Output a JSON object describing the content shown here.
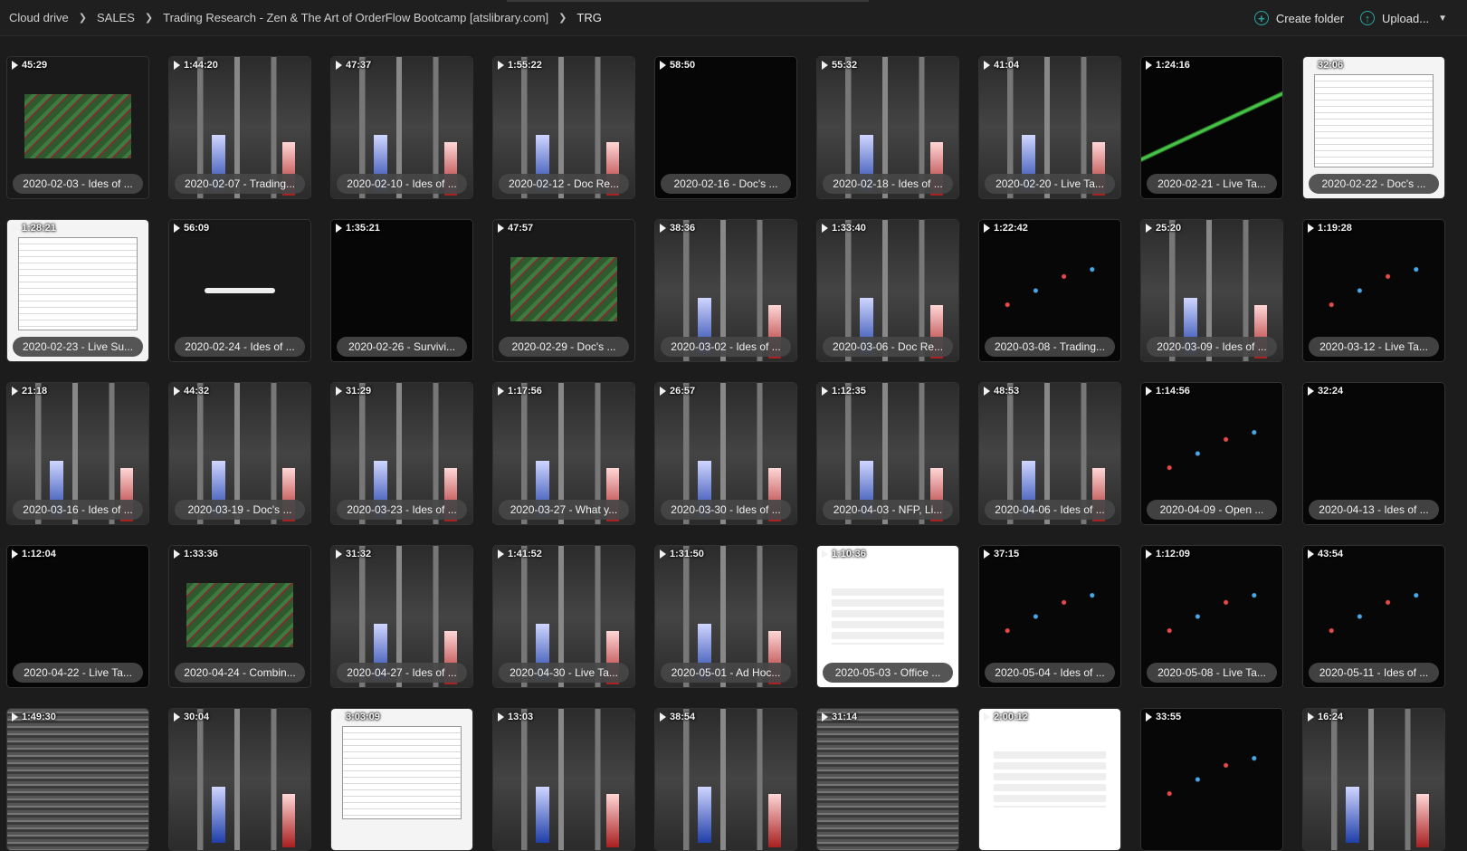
{
  "breadcrumb": [
    {
      "label": "Cloud drive"
    },
    {
      "label": "SALES"
    },
    {
      "label": "Trading Research - Zen & The Art of OrderFlow Bootcamp [atslibrary.com]"
    },
    {
      "label": "TRG"
    }
  ],
  "actions": {
    "create_folder": "Create folder",
    "upload": "Upload..."
  },
  "colors": {
    "accent": "#2aa7a2",
    "background": "#1c1c1d"
  },
  "tiles": [
    {
      "duration": "45:29",
      "title": "2020-02-03 - Ides of ...",
      "thumb": "promo"
    },
    {
      "duration": "1:44:20",
      "title": "2020-02-07 - Trading...",
      "thumb": "orderflow"
    },
    {
      "duration": "47:37",
      "title": "2020-02-10 - Ides of ...",
      "thumb": "orderflow"
    },
    {
      "duration": "1:55:22",
      "title": "2020-02-12 - Doc Re...",
      "thumb": "orderflow"
    },
    {
      "duration": "58:50",
      "title": "2020-02-16 - Doc's ...",
      "thumb": "dark"
    },
    {
      "duration": "55:32",
      "title": "2020-02-18 - Ides of ...",
      "thumb": "orderflow"
    },
    {
      "duration": "41:04",
      "title": "2020-02-20 - Live Ta...",
      "thumb": "orderflow"
    },
    {
      "duration": "1:24:16",
      "title": "2020-02-21 - Live Ta...",
      "thumb": "line"
    },
    {
      "duration": "32:06",
      "title": "2020-02-22 - Doc's ...",
      "thumb": "sheet"
    },
    {
      "duration": "1:28:21",
      "title": "2020-02-23 - Live Su...",
      "thumb": "sheet"
    },
    {
      "duration": "56:09",
      "title": "2020-02-24 - Ides of ...",
      "thumb": "google"
    },
    {
      "duration": "1:35:21",
      "title": "2020-02-26 - Survivi...",
      "thumb": "dark"
    },
    {
      "duration": "47:57",
      "title": "2020-02-29 - Doc's ...",
      "thumb": "promo"
    },
    {
      "duration": "38:36",
      "title": "2020-03-02 - Ides of ...",
      "thumb": "orderflow"
    },
    {
      "duration": "1:33:40",
      "title": "2020-03-06 - Doc Re...",
      "thumb": "orderflow"
    },
    {
      "duration": "1:22:42",
      "title": "2020-03-08 - Trading...",
      "thumb": "candles"
    },
    {
      "duration": "25:20",
      "title": "2020-03-09 - Ides of ...",
      "thumb": "orderflow"
    },
    {
      "duration": "1:19:28",
      "title": "2020-03-12 - Live Ta...",
      "thumb": "candles"
    },
    {
      "duration": "21:18",
      "title": "2020-03-16 - Ides of ...",
      "thumb": "orderflow"
    },
    {
      "duration": "44:32",
      "title": "2020-03-19 - Doc's ...",
      "thumb": "orderflow"
    },
    {
      "duration": "31:29",
      "title": "2020-03-23 - Ides of ...",
      "thumb": "orderflow"
    },
    {
      "duration": "1:17:56",
      "title": "2020-03-27 - What y...",
      "thumb": "orderflow"
    },
    {
      "duration": "26:57",
      "title": "2020-03-30 - Ides of ...",
      "thumb": "orderflow"
    },
    {
      "duration": "1:12:35",
      "title": "2020-04-03 - NFP, Li...",
      "thumb": "orderflow"
    },
    {
      "duration": "48:53",
      "title": "2020-04-06 - Ides of ...",
      "thumb": "orderflow"
    },
    {
      "duration": "1:14:56",
      "title": "2020-04-09 - Open ...",
      "thumb": "candles"
    },
    {
      "duration": "32:24",
      "title": "2020-04-13 - Ides of ...",
      "thumb": "dark"
    },
    {
      "duration": "1:12:04",
      "title": "2020-04-22 - Live Ta...",
      "thumb": "dark"
    },
    {
      "duration": "1:33:36",
      "title": "2020-04-24 - Combin...",
      "thumb": "promo"
    },
    {
      "duration": "31:32",
      "title": "2020-04-27 - Ides of ...",
      "thumb": "orderflow"
    },
    {
      "duration": "1:41:52",
      "title": "2020-04-30 - Live Ta...",
      "thumb": "orderflow"
    },
    {
      "duration": "1:31:50",
      "title": "2020-05-01 - Ad Hoc...",
      "thumb": "orderflow"
    },
    {
      "duration": "1:10:36",
      "title": "2020-05-03 - Office ...",
      "thumb": "white"
    },
    {
      "duration": "37:15",
      "title": "2020-05-04 - Ides of ...",
      "thumb": "candles"
    },
    {
      "duration": "1:12:09",
      "title": "2020-05-08 - Live Ta...",
      "thumb": "candles"
    },
    {
      "duration": "43:54",
      "title": "2020-05-11 - Ides of ...",
      "thumb": "candles"
    },
    {
      "duration": "1:49:30",
      "title": "",
      "thumb": "heat"
    },
    {
      "duration": "30:04",
      "title": "",
      "thumb": "orderflow"
    },
    {
      "duration": "3:03:09",
      "title": "",
      "thumb": "sheet"
    },
    {
      "duration": "13:03",
      "title": "",
      "thumb": "orderflow"
    },
    {
      "duration": "38:54",
      "title": "",
      "thumb": "orderflow"
    },
    {
      "duration": "31:14",
      "title": "",
      "thumb": "heat"
    },
    {
      "duration": "2:00:12",
      "title": "",
      "thumb": "white"
    },
    {
      "duration": "33:55",
      "title": "",
      "thumb": "candles"
    },
    {
      "duration": "16:24",
      "title": "",
      "thumb": "orderflow"
    }
  ]
}
